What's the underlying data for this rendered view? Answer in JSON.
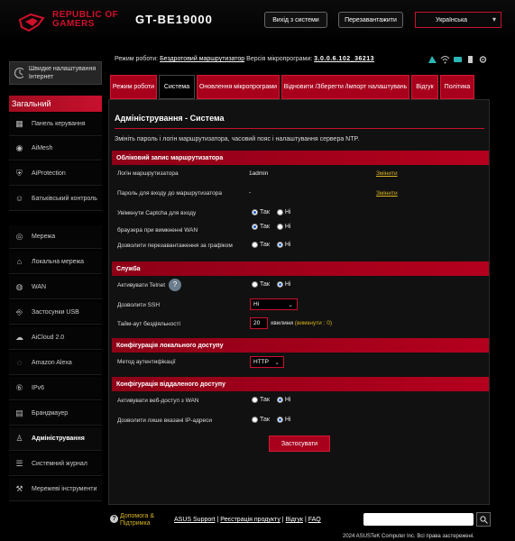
{
  "header": {
    "brand_line1": "REPUBLIC OF",
    "brand_line2": "GAMERS",
    "model": "GT-BE19000",
    "logout": "Вихід з системи",
    "reboot": "Перезавантажити",
    "language": "Українська"
  },
  "status": {
    "mode_label": "Режим роботи:",
    "mode_value": "Бездротовий маршрутизатор",
    "fw_label": "Версія мікропрограми:",
    "fw_value": "3.0.0.6.102_36213"
  },
  "sidebar": {
    "quick_setup": "Швидке налаштування Інтернет",
    "section": "Загальний",
    "items": [
      {
        "label": "Панель керування",
        "icon": "dashboard-icon"
      },
      {
        "label": "AiMesh",
        "icon": "mesh-icon"
      },
      {
        "label": "AiProtection",
        "icon": "shield-icon"
      },
      {
        "label": "Батьківський контроль",
        "icon": "parental-icon"
      },
      {
        "label": "Мережа",
        "icon": "network-icon"
      },
      {
        "label": "Локальна мережа",
        "icon": "lan-icon"
      },
      {
        "label": "WAN",
        "icon": "globe-icon"
      },
      {
        "label": "Застосунки USB",
        "icon": "usb-icon"
      },
      {
        "label": "AiCloud 2.0",
        "icon": "cloud-icon"
      },
      {
        "label": "Amazon Alexa",
        "icon": "alexa-icon"
      },
      {
        "label": "IPv6",
        "icon": "ipv6-icon"
      },
      {
        "label": "Брандмауер",
        "icon": "firewall-icon"
      },
      {
        "label": "Адміністрування",
        "icon": "admin-icon"
      },
      {
        "label": "Системний журнал",
        "icon": "log-icon"
      },
      {
        "label": "Мережеві інструменти",
        "icon": "tools-icon"
      }
    ]
  },
  "tabs": [
    {
      "label": "Режим роботи"
    },
    {
      "label": "Система"
    },
    {
      "label": "Оновлення мікропрограми"
    },
    {
      "label": "Відновити /Зберегти /Імпорт налаштувань"
    },
    {
      "label": "Відгук"
    },
    {
      "label": "Політика"
    }
  ],
  "main": {
    "title": "Адміністрування - Система",
    "description": "Змініть пароль і логін маршрутизатора, часовий пояс і налаштування сервера NTP.",
    "sections": {
      "account": "Обліковий запис маршрутизатора",
      "service": "Служба",
      "local_access": "Конфігурація локального доступу",
      "remote_access": "Конфігурація віддаленого доступу"
    },
    "rows": {
      "login_label": "Логін маршрутизатора",
      "login_value": "1admin",
      "change1": "Змінити",
      "password_label": "Пароль для входу до маршрутизатора",
      "password_value": "-",
      "change2": "Змінити",
      "captcha_label": "Увімкнути Captcha для входу",
      "browser_label": "браузера при вимкненні WAN",
      "reboot_schedule_label": "Дозволити перезавантаження за графіком",
      "telnet_label": "Активувати Telnet",
      "ssh_label": "Дозволити SSH",
      "ssh_value": "Ні",
      "idle_label": "Тайм-аут бездіяльності",
      "idle_value": "20",
      "idle_unit": "хвилини",
      "idle_hint": "(вимкнути : 0)",
      "auth_label": "Метод аутентифікації",
      "auth_value": "HTTP",
      "webaccess_label": "Активувати веб-доступ з WAN",
      "iplimit_label": "Дозволити лише вказані IP-адреси"
    },
    "radio_yes": "Так",
    "radio_no": "Ні",
    "apply": "Застосувати"
  },
  "footer": {
    "help": "Допомога & Підтримка",
    "asus_support": "ASUS Support",
    "registration": "Реєстрація продукту",
    "feedback": "Відгук",
    "faq": "FAQ",
    "sep": "|",
    "copyright": "2024 ASUSTeK Computer Inc. Всі права застережені."
  },
  "colors": {
    "accent": "#c8102e",
    "link": "#d8b320"
  }
}
